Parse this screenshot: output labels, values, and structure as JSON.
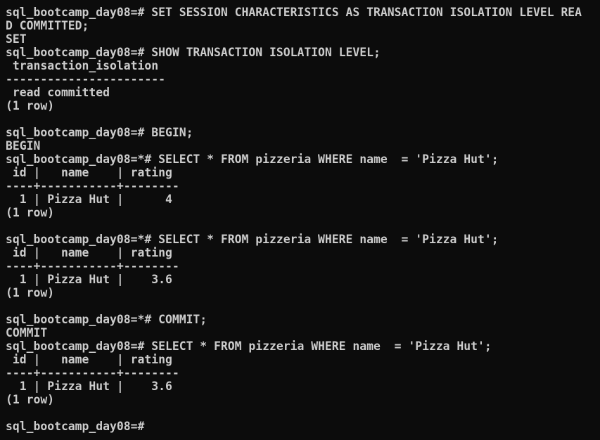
{
  "theme": {
    "background": "#0c0c0c",
    "foreground": "#cccccc"
  },
  "terminal": {
    "lines": [
      "sql_bootcamp_day08=# SET SESSION CHARACTERISTICS AS TRANSACTION ISOLATION LEVEL REA",
      "D COMMITTED;",
      "SET",
      "sql_bootcamp_day08=# SHOW TRANSACTION ISOLATION LEVEL;",
      " transaction_isolation",
      "-----------------------",
      " read committed",
      "(1 row)",
      "",
      "sql_bootcamp_day08=# BEGIN;",
      "BEGIN",
      "sql_bootcamp_day08=*# SELECT * FROM pizzeria WHERE name  = 'Pizza Hut';",
      " id |   name    | rating",
      "----+-----------+--------",
      "  1 | Pizza Hut |      4",
      "(1 row)",
      "",
      "sql_bootcamp_day08=*# SELECT * FROM pizzeria WHERE name  = 'Pizza Hut';",
      " id |   name    | rating",
      "----+-----------+--------",
      "  1 | Pizza Hut |    3.6",
      "(1 row)",
      "",
      "sql_bootcamp_day08=*# COMMIT;",
      "COMMIT",
      "sql_bootcamp_day08=# SELECT * FROM pizzeria WHERE name  = 'Pizza Hut';",
      " id |   name    | rating",
      "----+-----------+--------",
      "  1 | Pizza Hut |    3.6",
      "(1 row)",
      "",
      "sql_bootcamp_day08=#"
    ]
  }
}
